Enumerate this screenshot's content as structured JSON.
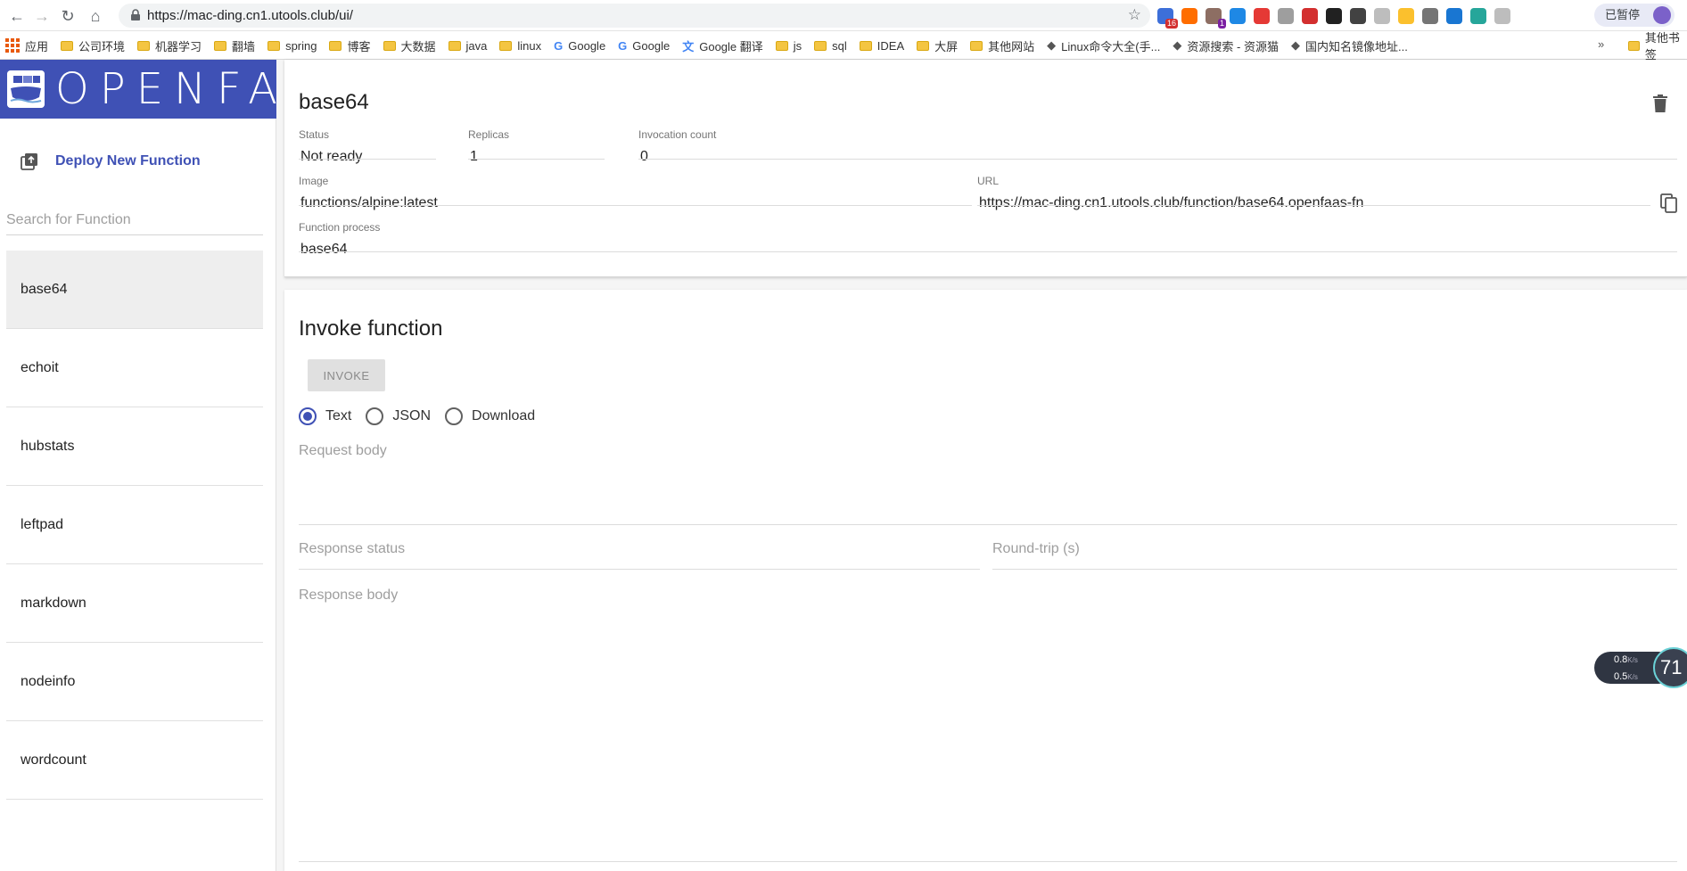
{
  "browser": {
    "url": "https://mac-ding.cn1.utools.club/ui/",
    "paused_label": "已暂停",
    "extensions": [
      {
        "icon": "extension-stats-icon",
        "color": "#3d6fd9",
        "badge": "16"
      },
      {
        "icon": "extension-infinity-icon",
        "color": "#ff6d00",
        "badge": ""
      },
      {
        "icon": "extension-tampermonkey-icon",
        "color": "#8d6e63",
        "badge": "1"
      },
      {
        "icon": "extension-bird-icon",
        "color": "#1e88e5",
        "badge": ""
      },
      {
        "icon": "extension-acrobat-icon",
        "color": "#e53935",
        "badge": ""
      },
      {
        "icon": "extension-eye-icon",
        "color": "#9e9e9e",
        "badge": ""
      },
      {
        "icon": "extension-fe-icon",
        "color": "#d32f2f",
        "badge": ""
      },
      {
        "icon": "extension-dark-icon",
        "color": "#212121",
        "badge": ""
      },
      {
        "icon": "extension-glasses-icon",
        "color": "#424242",
        "badge": ""
      },
      {
        "icon": "extension-pin-icon",
        "color": "#bdbdbd",
        "badge": ""
      },
      {
        "icon": "extension-y-icon",
        "color": "#fbc02d",
        "badge": ""
      },
      {
        "icon": "extension-download-icon",
        "color": "#757575",
        "badge": ""
      },
      {
        "icon": "extension-shield-icon",
        "color": "#1976d2",
        "badge": ""
      },
      {
        "icon": "extension-leaf-icon",
        "color": "#26a69a",
        "badge": ""
      },
      {
        "icon": "extension-book-icon",
        "color": "#bdbdbd",
        "badge": ""
      }
    ]
  },
  "bookmarks": {
    "apps_label": "应用",
    "items": [
      {
        "label": "公司环境",
        "type": "folder"
      },
      {
        "label": "机器学习",
        "type": "folder"
      },
      {
        "label": "翻墙",
        "type": "folder"
      },
      {
        "label": "spring",
        "type": "folder"
      },
      {
        "label": "博客",
        "type": "folder"
      },
      {
        "label": "大数据",
        "type": "folder"
      },
      {
        "label": "java",
        "type": "folder"
      },
      {
        "label": "linux",
        "type": "folder"
      },
      {
        "label": "Google",
        "type": "google"
      },
      {
        "label": "Google",
        "type": "google"
      },
      {
        "label": "Google 翻译",
        "type": "translate"
      },
      {
        "label": "js",
        "type": "folder"
      },
      {
        "label": "sql",
        "type": "folder"
      },
      {
        "label": "IDEA",
        "type": "folder"
      },
      {
        "label": "大屏",
        "type": "folder"
      },
      {
        "label": "其他网站",
        "type": "folder"
      },
      {
        "label": "Linux命令大全(手...",
        "type": "link"
      },
      {
        "label": "资源搜索 - 资源猫",
        "type": "link"
      },
      {
        "label": "国内知名镜像地址...",
        "type": "link"
      }
    ],
    "more_label": "»",
    "other_label": "其他书签"
  },
  "sidebar": {
    "logo_text": "OPENFAAS",
    "deploy_label": "Deploy New Function",
    "search_placeholder": "Search for Function",
    "functions": [
      "base64",
      "echoit",
      "hubstats",
      "leftpad",
      "markdown",
      "nodeinfo",
      "wordcount"
    ],
    "selected_index": 0
  },
  "detail": {
    "title": "base64",
    "status_label": "Status",
    "status_value": "Not ready",
    "replicas_label": "Replicas",
    "replicas_value": "1",
    "invocation_label": "Invocation count",
    "invocation_value": "0",
    "image_label": "Image",
    "image_value": "functions/alpine:latest",
    "url_label": "URL",
    "url_value": "https://mac-ding.cn1.utools.club/function/base64.openfaas-fn",
    "process_label": "Function process",
    "process_value": "base64"
  },
  "invoke": {
    "title": "Invoke function",
    "button_label": "INVOKE",
    "formats": [
      "Text",
      "JSON",
      "Download"
    ],
    "selected_format": "Text",
    "request_body_placeholder": "Request body",
    "response_status_placeholder": "Response status",
    "round_trip_placeholder": "Round-trip (s)",
    "response_body_placeholder": "Response body"
  },
  "speed_widget": {
    "up": "0.8",
    "down": "0.5",
    "unit": "K/s",
    "gauge": "71"
  },
  "colors": {
    "accent": "#3f51b5",
    "selected_row": "#eeeeee",
    "muted_text": "#9e9e9e"
  }
}
